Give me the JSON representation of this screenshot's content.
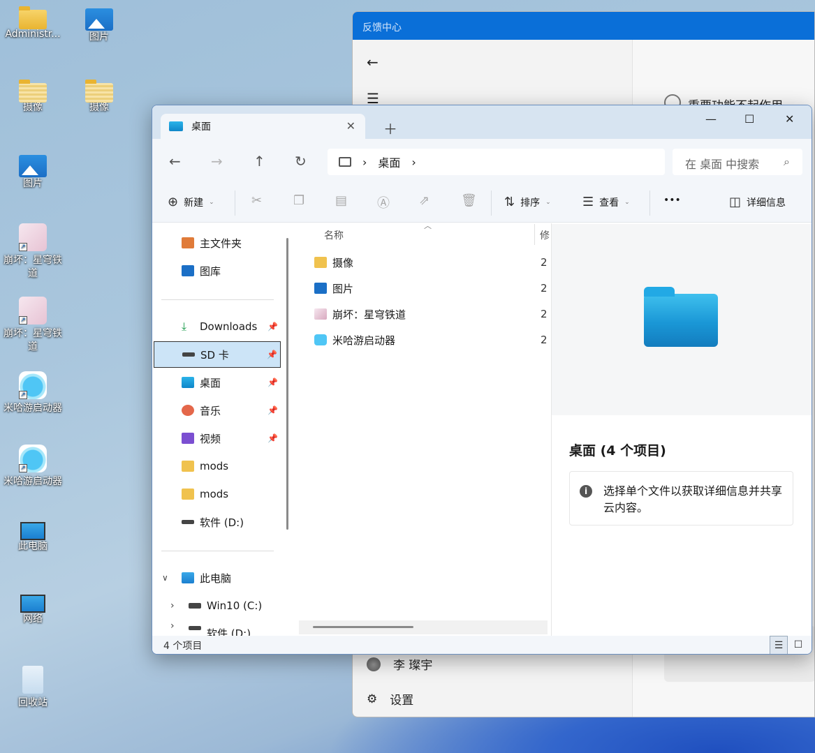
{
  "desktop": {
    "icons": [
      {
        "label": "Administr...",
        "icon": "folder-icon"
      },
      {
        "label": "图片",
        "icon": "picture-folder-icon"
      },
      {
        "label": "摄像",
        "icon": "striped-folder-icon"
      },
      {
        "label": "摄像",
        "icon": "striped-folder-icon"
      },
      {
        "label": "图片",
        "icon": "picture-folder-icon"
      },
      {
        "label": "崩坏：星穹铁道",
        "icon": "game-shortcut-icon"
      },
      {
        "label": "崩坏：星穹铁道",
        "icon": "game-shortcut-icon"
      },
      {
        "label": "米哈游启动器",
        "icon": "mihoyo-launcher-icon"
      },
      {
        "label": "米哈游启动器",
        "icon": "mihoyo-launcher-icon"
      },
      {
        "label": "此电脑",
        "icon": "this-pc-icon"
      },
      {
        "label": "网络",
        "icon": "network-icon"
      },
      {
        "label": "回收站",
        "icon": "recycle-bin-icon"
      }
    ]
  },
  "feedback": {
    "title": "反馈中心",
    "option_text": "重要功能不起作用",
    "user_name": "李 璨宇",
    "settings_label": "设置"
  },
  "explorer": {
    "tab_title": "桌面",
    "address": {
      "segment": "桌面"
    },
    "search_placeholder": "在 桌面 中搜索",
    "toolbar": {
      "new_label": "新建",
      "sort_label": "排序",
      "view_label": "查看",
      "more_label": "•••",
      "details_label": "详细信息"
    },
    "nav": [
      {
        "label": "主文件夹",
        "icon": "home-icon",
        "pinned": false
      },
      {
        "label": "图库",
        "icon": "gallery-icon",
        "pinned": false
      },
      {
        "label": "Downloads",
        "icon": "download-icon",
        "pinned": true
      },
      {
        "label": "SD 卡",
        "icon": "drive-icon",
        "pinned": true,
        "selected": true
      },
      {
        "label": "桌面",
        "icon": "desktop-icon",
        "pinned": true
      },
      {
        "label": "音乐",
        "icon": "music-icon",
        "pinned": true
      },
      {
        "label": "视频",
        "icon": "video-icon",
        "pinned": true
      },
      {
        "label": "mods",
        "icon": "folder-icon",
        "pinned": false
      },
      {
        "label": "mods",
        "icon": "folder-icon",
        "pinned": false
      },
      {
        "label": "软件 (D:)",
        "icon": "drive-icon",
        "pinned": false
      },
      {
        "label": "此电脑",
        "icon": "this-pc-icon",
        "pinned": false
      },
      {
        "label": "Win10 (C:)",
        "icon": "windows-drive-icon",
        "pinned": false
      },
      {
        "label": "软件 (D:)",
        "icon": "drive-icon",
        "pinned": false
      }
    ],
    "columns": {
      "name": "名称",
      "modified": "修"
    },
    "files": [
      {
        "name": "摄像",
        "icon": "folder-icon",
        "date": "2"
      },
      {
        "name": "图片",
        "icon": "picture-folder-icon",
        "date": "2"
      },
      {
        "name": "崩坏：星穹铁道",
        "icon": "game-shortcut-icon",
        "date": "2"
      },
      {
        "name": "米哈游启动器",
        "icon": "mihoyo-launcher-icon",
        "date": "2"
      }
    ],
    "details": {
      "title": "桌面 (4 个项目)",
      "info": "选择单个文件以获取详细信息并共享云内容。"
    },
    "status": "4 个项目",
    "colors": {
      "accent": "#0a6fd8",
      "selection": "#cce4f7",
      "tabbar": "#d7e4f1"
    }
  }
}
